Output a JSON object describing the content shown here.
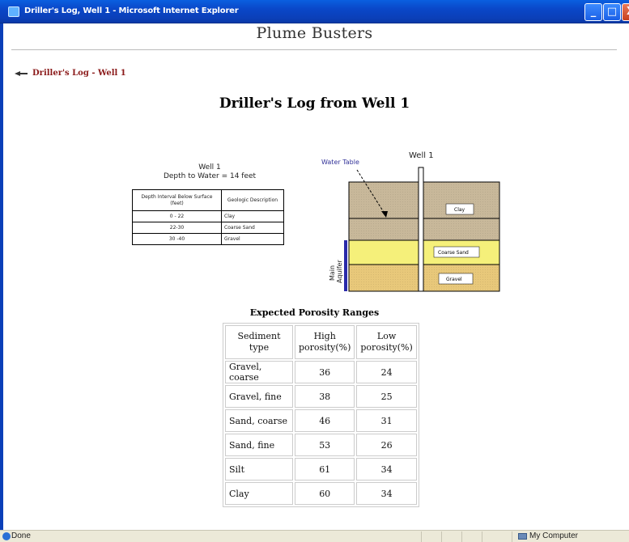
{
  "window": {
    "title": "Driller's Log, Well 1 - Microsoft Internet Explorer",
    "minimize": "_",
    "maximize": "□",
    "close": "X"
  },
  "page": {
    "brand": "Plume Busters",
    "back_link": "Driller's Log - Well 1",
    "title": "Driller's Log from Well 1"
  },
  "well_log": {
    "caption_line1": "Well 1",
    "caption_line2": "Depth to Water = 14 feet",
    "headers": [
      "Depth Interval Below Surface (feet)",
      "Geologic Description"
    ],
    "rows": [
      [
        "0 - 22",
        "Clay"
      ],
      [
        "22-30",
        "Coarse Sand"
      ],
      [
        "30 -40",
        "Gravel"
      ]
    ]
  },
  "diagram": {
    "well_label": "Well 1",
    "water_table_label": "Water Table",
    "aquifer_label_line1": "Main",
    "aquifer_label_line2": "Aquifer",
    "layers": [
      {
        "label": "Clay",
        "color": "#c8b89a"
      },
      {
        "label": "Coarse Sand",
        "color": "#f5f07a"
      },
      {
        "label": "Gravel",
        "color": "#e8c87a"
      }
    ],
    "aquifer_color": "#2a2aaa",
    "water_table_color": "#333399"
  },
  "porosity": {
    "title": "Expected Porosity Ranges",
    "headers": [
      "Sediment type",
      "High porosity(%)",
      "Low porosity(%)"
    ],
    "rows": [
      [
        "Gravel, coarse",
        "36",
        "24"
      ],
      [
        "Gravel, fine",
        "38",
        "25"
      ],
      [
        "Sand, coarse",
        "46",
        "31"
      ],
      [
        "Sand, fine",
        "53",
        "26"
      ],
      [
        "Silt",
        "61",
        "34"
      ],
      [
        "Clay",
        "60",
        "34"
      ]
    ]
  },
  "status": {
    "left": "Done",
    "zone": "My Computer"
  }
}
